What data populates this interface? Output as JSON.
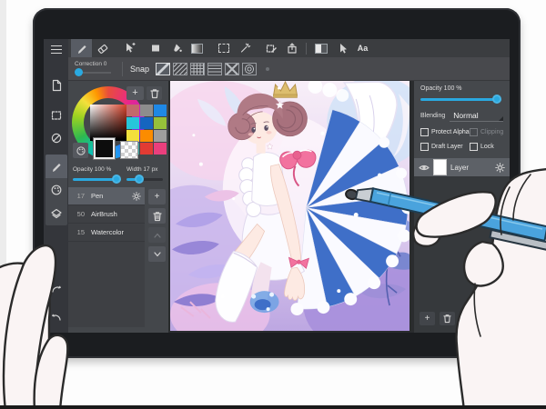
{
  "ui": {
    "plus": "+",
    "aa": "Aa"
  },
  "subbar": {
    "correction_label": "Correction 0",
    "snap_label": "Snap"
  },
  "tool_panel": {
    "opacity_label": "Opacity 100 %",
    "width_label": "Width 17 px",
    "brushes": [
      {
        "size": "17",
        "name": "Pen"
      },
      {
        "size": "50",
        "name": "AirBrush"
      },
      {
        "size": "15",
        "name": "Watercolor"
      }
    ],
    "swatches": [
      "#c4686c",
      "#8d8d8d",
      "#1e88e5",
      "#26c6da",
      "#1565c0",
      "#96c03a",
      "#f3e03c",
      "#fb8c00",
      "#9e9e9e",
      "#3fa9a2",
      "#e23b33",
      "#ea3f7d"
    ]
  },
  "layer_panel": {
    "opacity_label": "Opacity 100 %",
    "blending_label": "Blending",
    "blending_value": "Normal",
    "protect_alpha_label": "Protect Alpha",
    "clipping_label": "Clipping",
    "draft_label": "Draft Layer",
    "lock_label": "Lock",
    "layer_name": "Layer"
  },
  "colors": {
    "accent": "#2aa9e0",
    "stylus": "#4aa3dd",
    "canvas_bg": "#2a2c2e",
    "bezel": "#1b1d20"
  }
}
